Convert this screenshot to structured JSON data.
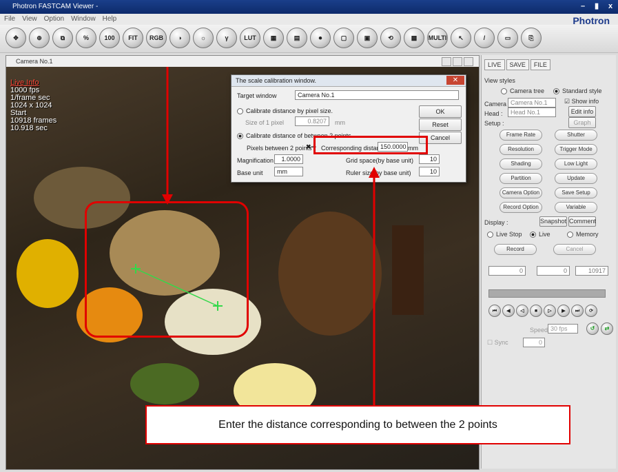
{
  "titlebar": {
    "title": "Photron FASTCAM Viewer -",
    "min": "–",
    "max": "▮",
    "close": "x"
  },
  "menubar": {
    "items": [
      "File",
      "View",
      "Option",
      "Window",
      "Help"
    ]
  },
  "brand": "Photron",
  "toolbar": {
    "buttons": [
      "✥",
      "⊕",
      "⧉",
      "%",
      "100",
      "FIT",
      "RGB",
      "◑",
      "☼",
      "γ",
      "LUT",
      "▦",
      "▤",
      "⏺",
      "▢",
      "▣",
      "⟲",
      "▩",
      "MULTI",
      "↖",
      "/",
      "▭",
      "⎘"
    ]
  },
  "viewer": {
    "camera_label": "Camera No.1",
    "live_info": "Live Info",
    "info_lines": [
      "1000 fps",
      "1/frame sec",
      "1024 x 1024",
      "Start",
      "10918 frames",
      "10.918 sec"
    ]
  },
  "dialog": {
    "title": "The scale calibration window.",
    "target_label": "Target window",
    "target_value": "Camera No.1",
    "option1": "Calibrate distance by pixel size.",
    "size_label": "Size of 1 pixel",
    "size_value": "0.8207",
    "size_unit": "mm",
    "option2": "Calibrate distance of between 2 points",
    "pixels_label": "Pixels between 2 points",
    "corr_label": "Corresponding distance",
    "corr_value": "150.0000",
    "corr_unit": "mm",
    "mag_label": "Magnification",
    "mag_value": "1.0000",
    "base_label": "Base unit",
    "base_value": "mm",
    "grid_label": "Grid space(by base unit)",
    "grid_value": "10",
    "ruler_label": "Ruler size(by base unit)",
    "ruler_value": "10",
    "ok": "OK",
    "reset": "Reset",
    "cancel": "Cancel"
  },
  "right": {
    "tabs": [
      "LIVE",
      "SAVE",
      "FILE"
    ],
    "view_styles": "View styles",
    "camera_tree": "Camera tree",
    "standard_style": "Standard style",
    "camera_label": "Camera",
    "camera_value": "Camera No.1",
    "head_label": "Head :",
    "head_value": "Head No.1",
    "show_info": "Show info",
    "edit_info": "Edit info",
    "setup": "Setup :",
    "graph": "Graph",
    "buttons": [
      "Frame Rate",
      "Shutter",
      "Resolution",
      "Trigger Mode",
      "Shading",
      "Low Light",
      "Partition",
      "Update",
      "Camera Option",
      "Save Setup",
      "Record Option",
      "Variable"
    ],
    "display": "Display :",
    "snapshot": "Snapshot",
    "comment": "Comment",
    "live_stop": "Live Stop",
    "live": "Live",
    "memory": "Memory",
    "record": "Record",
    "cancel": "Cancel",
    "frame_start": "0",
    "frame_mid": "0",
    "frame_end": "10917",
    "speed_label": "Speed",
    "fps_value": "30 fps",
    "sync_label": "Sync",
    "sync_value": "0"
  },
  "annotation": {
    "callout": "Enter the distance corresponding to between the 2 points"
  },
  "colors": {
    "highlight": "#e10000",
    "crosshair": "#34d84a",
    "title_blue": "#1a3f8a"
  }
}
